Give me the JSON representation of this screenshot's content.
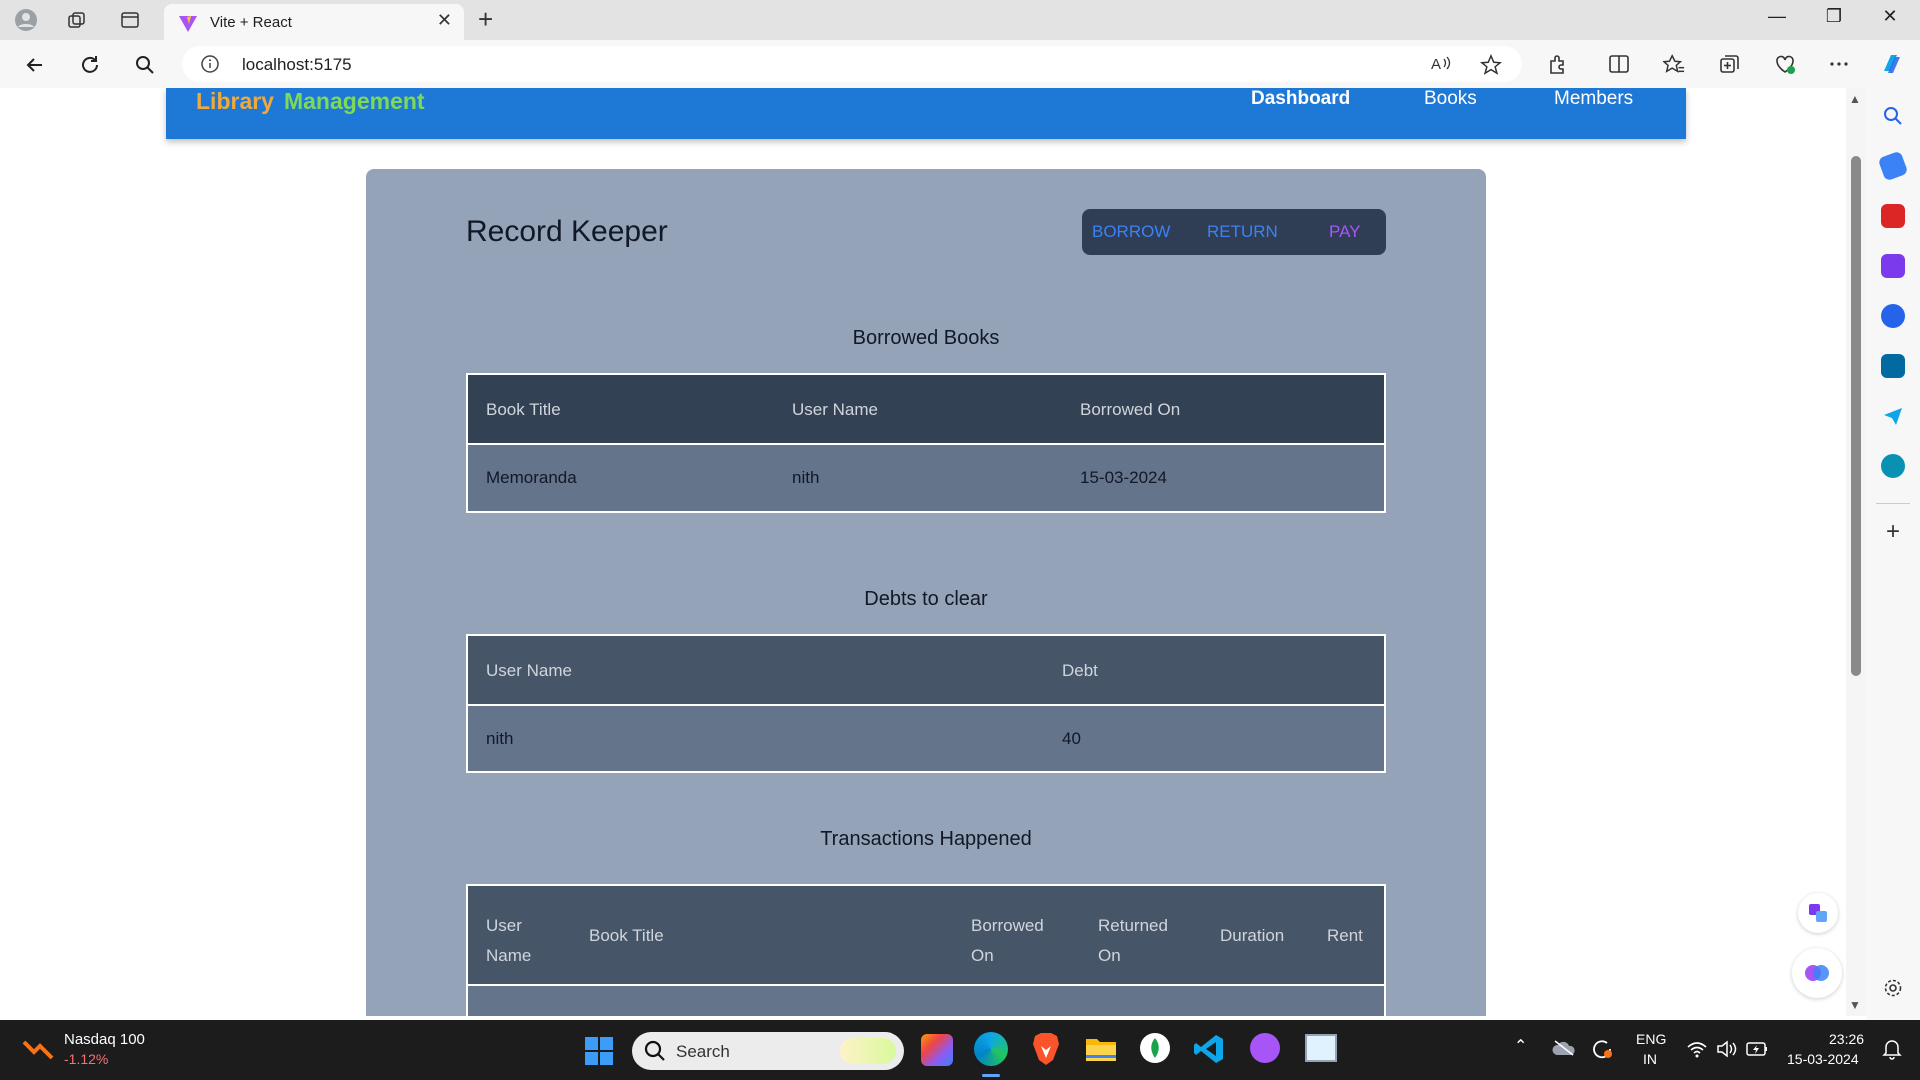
{
  "browser": {
    "tab_title": "Vite + React",
    "url": "localhost:5175"
  },
  "app": {
    "brand_part1": "Library",
    "brand_part2": "Management",
    "nav": [
      "Dashboard",
      "Books",
      "Members"
    ],
    "active_nav": "Dashboard"
  },
  "page": {
    "title": "Record Keeper",
    "actions": [
      "BORROW",
      "RETURN",
      "PAY"
    ],
    "borrowed": {
      "title": "Borrowed Books",
      "headers": [
        "Book Title",
        "User Name",
        "Borrowed On"
      ],
      "rows": [
        [
          "Memoranda",
          "nith",
          "15-03-2024"
        ]
      ]
    },
    "debts": {
      "title": "Debts to clear",
      "headers": [
        "User Name",
        "Debt"
      ],
      "rows": [
        [
          "nith",
          "40"
        ]
      ]
    },
    "transactions": {
      "title": "Transactions Happened",
      "headers": [
        "User Name",
        "Book Title",
        "Borrowed On",
        "Returned On",
        "Duration",
        "Rent"
      ]
    }
  },
  "taskbar": {
    "stock_name": "Nasdaq 100",
    "stock_change": "-1.12%",
    "search_placeholder": "Search",
    "lang_line1": "ENG",
    "lang_line2": "IN",
    "time": "23:26",
    "date": "15-03-2024"
  },
  "colors": {
    "nav_bg": "#1e78d6",
    "panel_bg": "#94a3b8",
    "table_header_borrowed": "#334155",
    "table_header_other": "#475569",
    "table_row": "#64748b",
    "brand_library": "#f0a93b",
    "brand_management": "#7ed957",
    "action_blue": "#3b82f6",
    "action_purple": "#a855f7"
  }
}
